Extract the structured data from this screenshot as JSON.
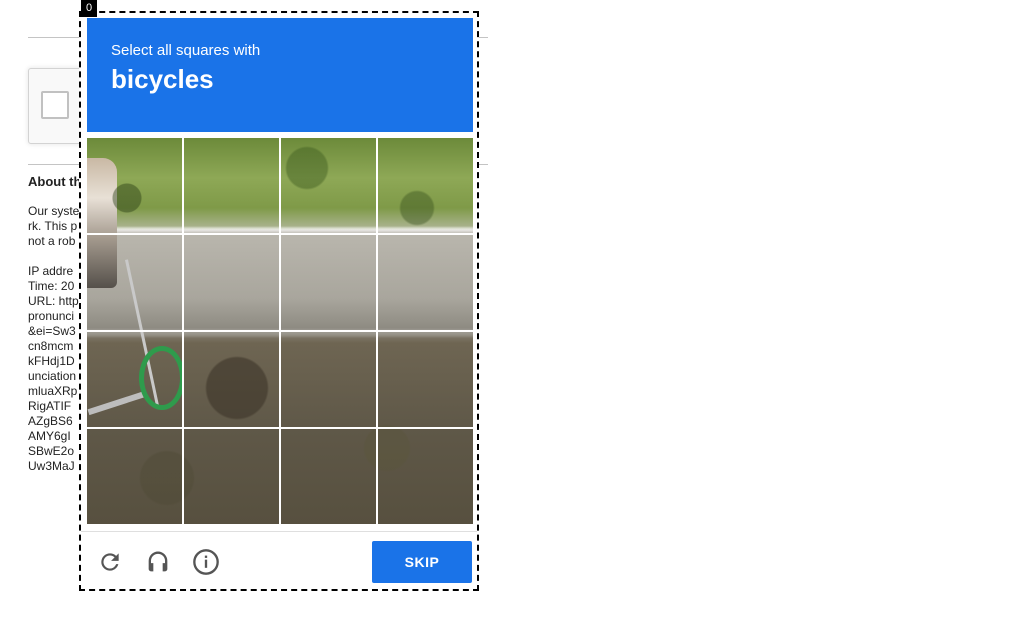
{
  "background": {
    "heading": "About th",
    "lines": [
      "Our syste",
      "rk. This p",
      "not a rob",
      "",
      "IP addre",
      "Time: 20",
      "URL: http",
      "pronunci",
      "&ei=Sw3",
      "cn8mcm",
      "kFHdj1D",
      "unciation",
      "mluaXRp",
      "RigATIF",
      "AZgBS6",
      "AMY6gI",
      "SBwE2o",
      "Uw3MaJ"
    ]
  },
  "challenge": {
    "counter": "0",
    "instruction": "Select all squares with",
    "target": "bicycles",
    "grid": {
      "rows": 4,
      "cols": 4
    },
    "footer": {
      "reload_icon": "reload-icon",
      "audio_icon": "headphones-icon",
      "info_icon": "info-icon",
      "skip_label": "SKIP"
    }
  },
  "colors": {
    "accent": "#1a73e8",
    "scooter_wheel": "#2f9b4c"
  }
}
